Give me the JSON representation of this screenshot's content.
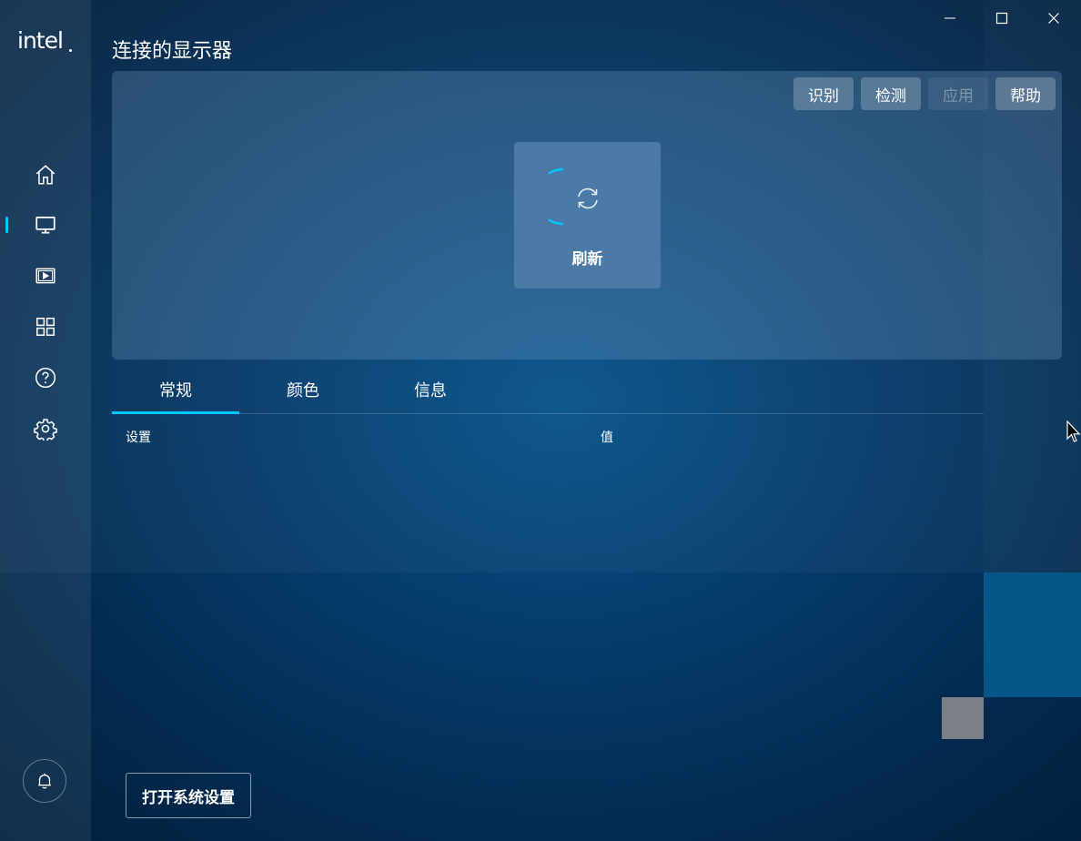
{
  "app": {
    "logo_text": "intel",
    "page_title": "连接的显示器"
  },
  "window_controls": {
    "minimize_icon": "minimize-icon",
    "maximize_icon": "maximize-icon",
    "close_icon": "close-icon"
  },
  "sidebar": {
    "items": [
      {
        "icon": "home-icon"
      },
      {
        "icon": "display-icon",
        "active": true
      },
      {
        "icon": "video-icon"
      },
      {
        "icon": "grid-icon"
      },
      {
        "icon": "help-icon"
      },
      {
        "icon": "gear-icon"
      }
    ],
    "bell_icon": "bell-icon",
    "accent_color": "#00c7fd"
  },
  "toolbar": {
    "identify_label": "识别",
    "detect_label": "检测",
    "apply_label": "应用",
    "help_label": "帮助"
  },
  "refresh": {
    "label": "刷新",
    "icon": "refresh-icon"
  },
  "tabs": [
    {
      "label": "常规",
      "active": true
    },
    {
      "label": "颜色"
    },
    {
      "label": "信息"
    }
  ],
  "table": {
    "columns": [
      "设置",
      "值"
    ]
  },
  "footer": {
    "open_settings_label": "打开系统设置"
  }
}
